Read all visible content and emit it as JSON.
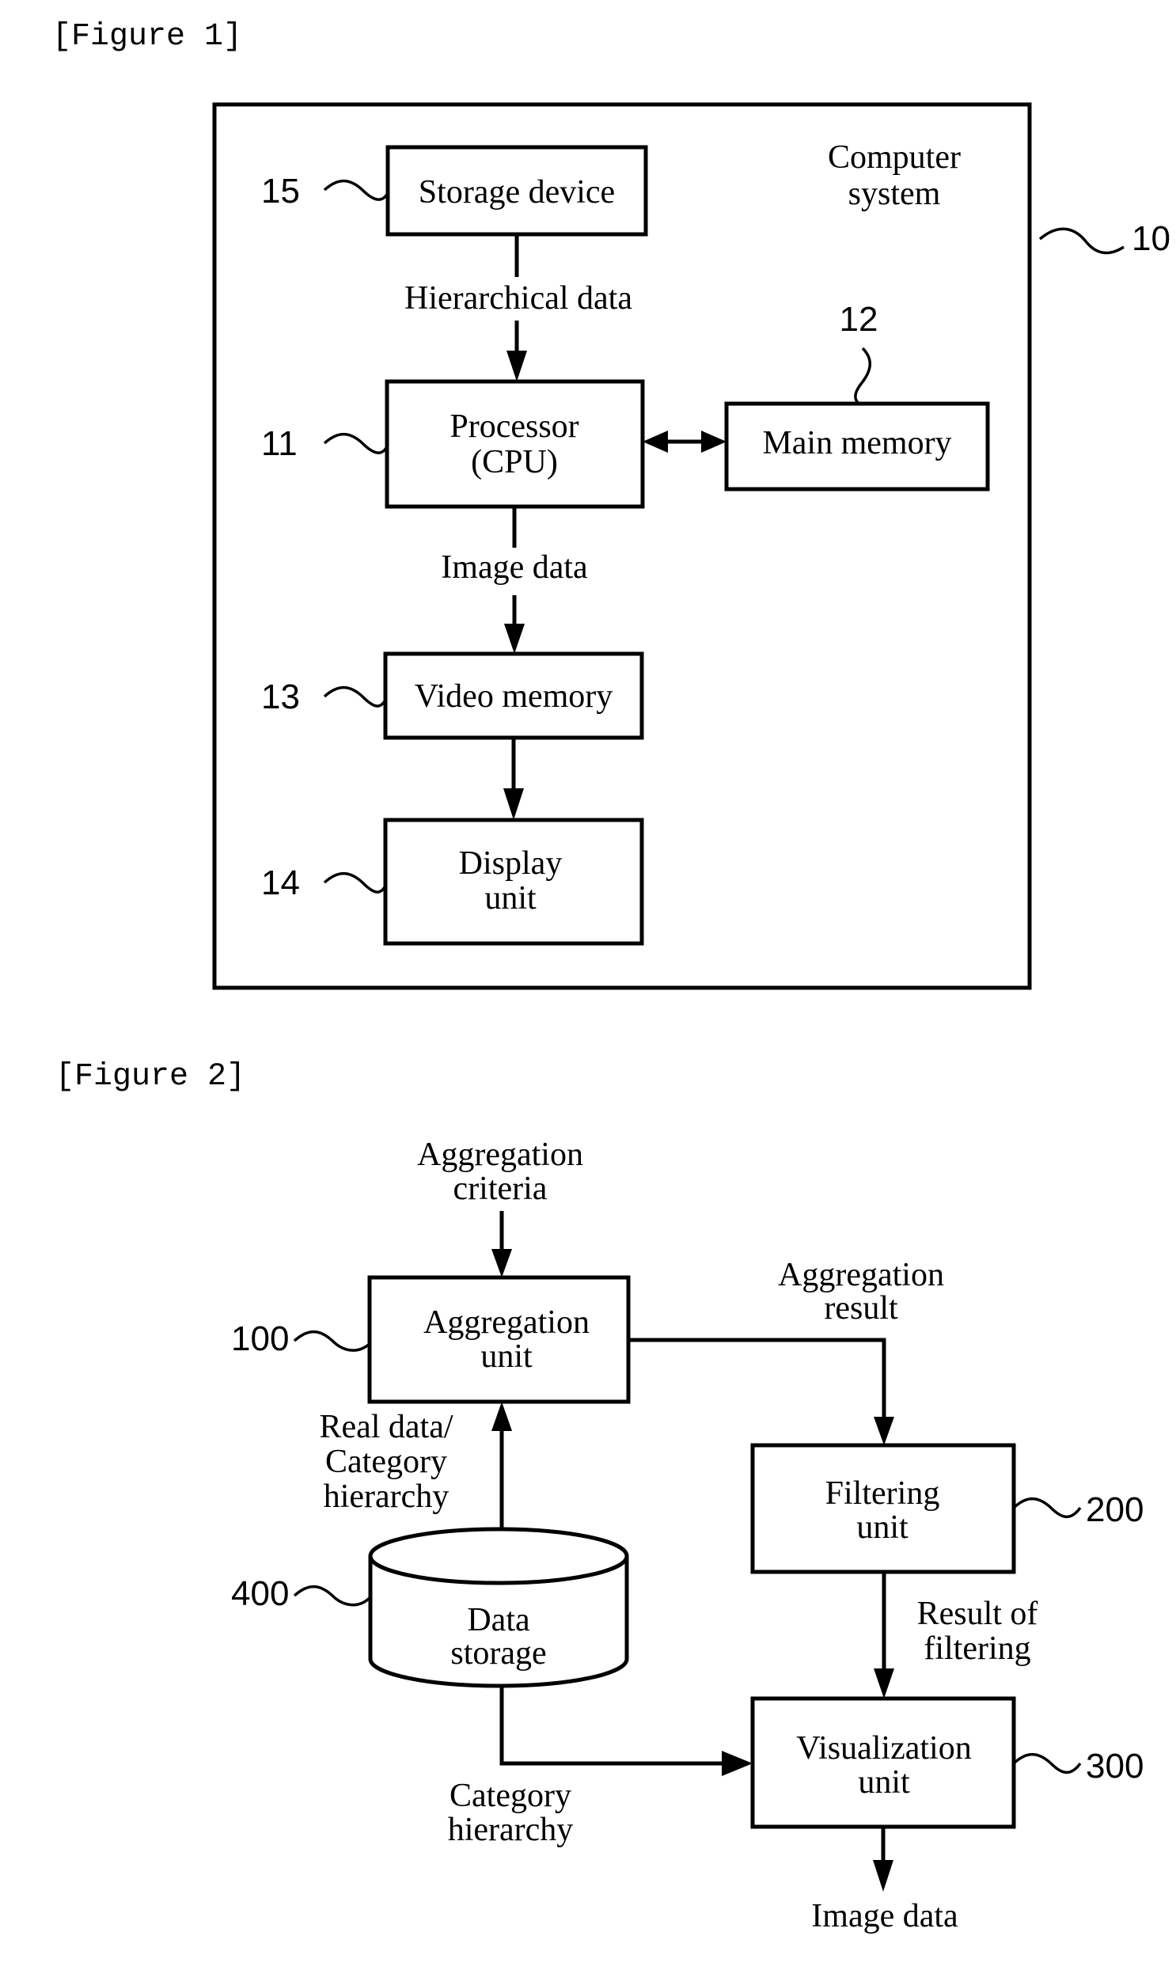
{
  "figure1": {
    "title": "[Figure 1]",
    "system": {
      "line1": "Computer",
      "line2": "system",
      "ref": "10"
    },
    "boxes": {
      "storage": {
        "label": "Storage device",
        "ref": "15"
      },
      "processor": {
        "line1": "Processor",
        "line2": "(CPU)",
        "ref": "11"
      },
      "main_memory": {
        "label": "Main memory",
        "ref": "12"
      },
      "video_memory": {
        "label": "Video memory",
        "ref": "13"
      },
      "display": {
        "line1": "Display",
        "line2": "unit",
        "ref": "14"
      }
    },
    "edges": {
      "storage_to_processor": "Hierarchical data",
      "processor_to_video": "Image data"
    }
  },
  "figure2": {
    "title": "[Figure 2]",
    "boxes": {
      "aggregation": {
        "line1": "Aggregation",
        "line2": "unit",
        "ref": "100"
      },
      "filtering": {
        "line1": "Filtering",
        "line2": "unit",
        "ref": "200"
      },
      "visualization": {
        "line1": "Visualization",
        "line2": "unit",
        "ref": "300"
      },
      "data_storage": {
        "line1": "Data",
        "line2": "storage",
        "ref": "400"
      }
    },
    "edges": {
      "criteria": {
        "line1": "Aggregation",
        "line2": "criteria"
      },
      "result": {
        "line1": "Aggregation",
        "line2": "result"
      },
      "real_data": {
        "line1": "Real data/",
        "line2": "Category",
        "line3": "hierarchy"
      },
      "filter_result": {
        "line1": "Result of",
        "line2": "filtering"
      },
      "category": {
        "line1": "Category",
        "line2": "hierarchy"
      },
      "output": "Image data"
    }
  }
}
